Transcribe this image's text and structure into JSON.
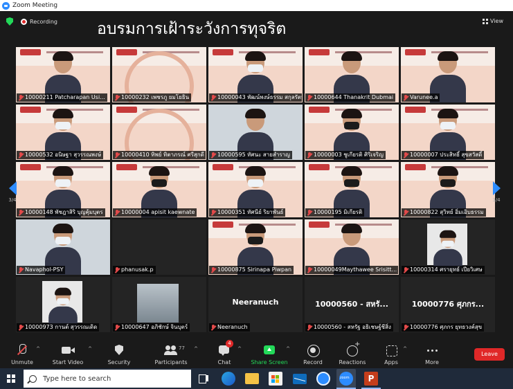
{
  "window": {
    "title": "Zoom Meeting"
  },
  "topbar": {
    "recording_label": "Recording",
    "banner_text": "อบรมการเฝ้าระวังการทุจริต",
    "view_label": "View"
  },
  "pager": {
    "left_page": "3/4",
    "right_page": "3/4"
  },
  "tiles": [
    {
      "name": "10000211 Patcharapan Usi...",
      "kind": "slide-person",
      "mask": "none"
    },
    {
      "name": "10000232 เพชรภู ยมโยธิน",
      "kind": "slide",
      "mask": "none"
    },
    {
      "name": "10000043 พัฒน์พงษ์ธรรม สกุลรัตน์...",
      "kind": "slide-person",
      "mask": "white"
    },
    {
      "name": "10000644 Thanakrit Dubmai",
      "kind": "slide-person",
      "mask": "none"
    },
    {
      "name": "Varunee.a",
      "kind": "slide-person",
      "mask": "none"
    },
    {
      "name": "10000532 อนิษฐา สุวรรณพงษ์",
      "kind": "slide-person",
      "mask": "white"
    },
    {
      "name": "10000410 ทิพย์ ทิตาภรณ์ ศรีสุกดี",
      "kind": "slide",
      "mask": "none"
    },
    {
      "name": "10000595 ทัศนะ สายสำราญ",
      "kind": "video-person",
      "mask": "none"
    },
    {
      "name": "10000003 ชูเกียรติ ศิริเจริญ",
      "kind": "slide-person",
      "mask": "black"
    },
    {
      "name": "10000007 ประสิทธิ์ สุขสวัสดิ์",
      "kind": "slide-person",
      "mask": "white"
    },
    {
      "name": "10000148 พัชฎาสิริ บุญคุ้มบุตร",
      "kind": "slide-person",
      "mask": "white"
    },
    {
      "name": "10000004 apisit  kaewnate",
      "kind": "slide-person",
      "mask": "black"
    },
    {
      "name": "10000351 ทัศนีย์ ริยาพันธ์",
      "kind": "slide-person",
      "mask": "white"
    },
    {
      "name": "10000195 มิเกียรติ",
      "kind": "slide-person",
      "mask": "black"
    },
    {
      "name": "10000822 สุวิทย์ อิ่มเอิบธรรม",
      "kind": "slide-person",
      "mask": "black"
    },
    {
      "name": "Navaphol-PSY",
      "kind": "video-person",
      "mask": "white"
    },
    {
      "name": "phanusak.p",
      "kind": "dark",
      "mask": "none"
    },
    {
      "name": "10000875 Sirinapa Piwpan",
      "kind": "slide-person",
      "mask": "black"
    },
    {
      "name": "10000049Maythawee Srisitt...",
      "kind": "slide-person",
      "mask": "none"
    },
    {
      "name": "10000314 ศรายุทธ์ เปียวิเศษ",
      "kind": "dark-person",
      "mask": "white"
    },
    {
      "name": "10000973 กานต์ สุวรรณเดิด",
      "kind": "dark-person",
      "mask": "white"
    },
    {
      "name": "10000647 อภิชักษ์ จินบุตร์",
      "kind": "dark-video",
      "mask": "none"
    },
    {
      "name": "Neeranuch",
      "kind": "dark-bigname",
      "bigname": "Neeranuch",
      "mask": "none"
    },
    {
      "name": "10000560 - สหรัฐ อธิเชษฐ์ชีสิ่ง",
      "kind": "dark-bigname",
      "bigname": "10000560 - สหรั...",
      "mask": "none"
    },
    {
      "name": "10000776 ศุภกร ยุทธวงค์สุข",
      "kind": "dark-bigname",
      "bigname": "10000776 ศุภกร...",
      "mask": "none"
    }
  ],
  "toolbar": {
    "unmute": "Unmute",
    "start_video": "Start Video",
    "security": "Security",
    "participants": "Participants",
    "participants_count": "77",
    "chat": "Chat",
    "chat_badge": "4",
    "share_screen": "Share Screen",
    "record": "Record",
    "reactions": "Reactions",
    "apps": "Apps",
    "more": "More",
    "leave": "Leave"
  },
  "taskbar": {
    "search_placeholder": "Type here to search"
  },
  "colors": {
    "zoom_blue": "#2d8cff",
    "leave_red": "#e02828",
    "share_green": "#23d959",
    "meeting_bg": "#1a1a1a"
  }
}
